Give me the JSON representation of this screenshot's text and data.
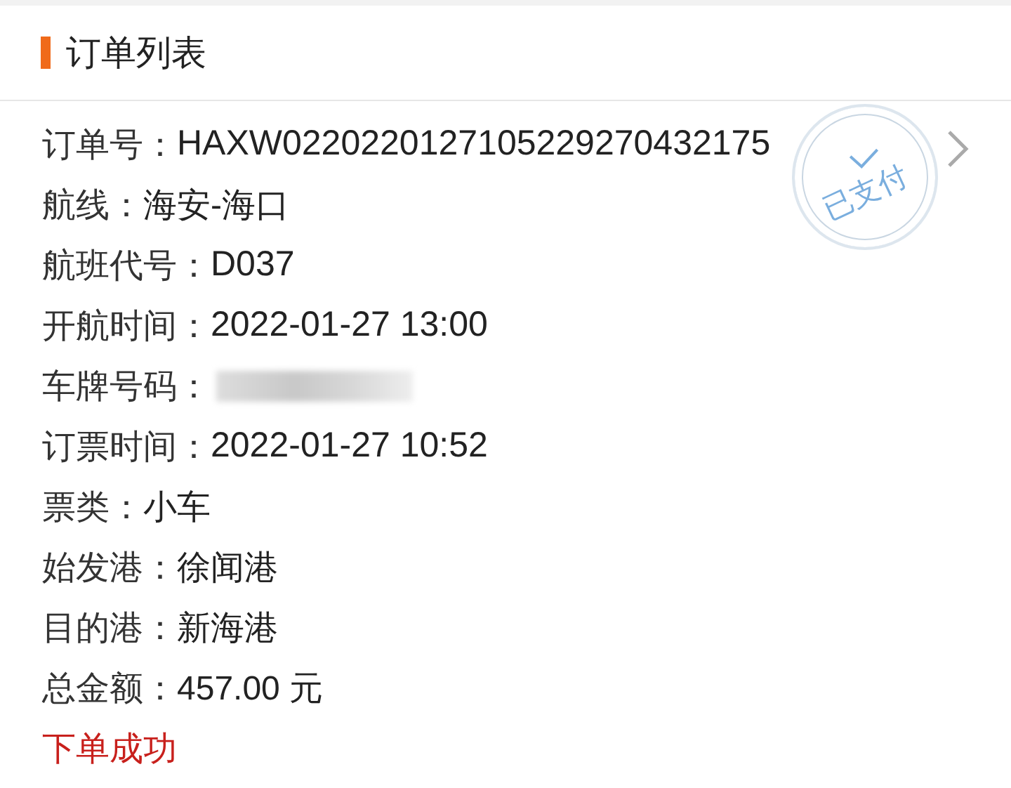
{
  "header": {
    "title": "订单列表"
  },
  "order": {
    "stamp": "已支付",
    "fields": [
      {
        "kind": "text",
        "label": "订单号：",
        "value": "HAXW0220220127105229270432175"
      },
      {
        "kind": "text",
        "label": "航线：",
        "value": "海安-海口"
      },
      {
        "kind": "text",
        "label": "航班代号：",
        "value": "D037"
      },
      {
        "kind": "text",
        "label": "开航时间：",
        "value": "2022-01-27 13:00"
      },
      {
        "kind": "redacted",
        "label": "车牌号码："
      },
      {
        "kind": "text",
        "label": "订票时间：",
        "value": "2022-01-27 10:52"
      },
      {
        "kind": "text",
        "label": "票类：",
        "value": "小车"
      },
      {
        "kind": "text",
        "label": "始发港：",
        "value": "徐闻港"
      },
      {
        "kind": "text",
        "label": "目的港：",
        "value": "新海港"
      },
      {
        "kind": "text",
        "label": "总金额：",
        "value": "457.00 元"
      }
    ],
    "status": "下单成功"
  }
}
